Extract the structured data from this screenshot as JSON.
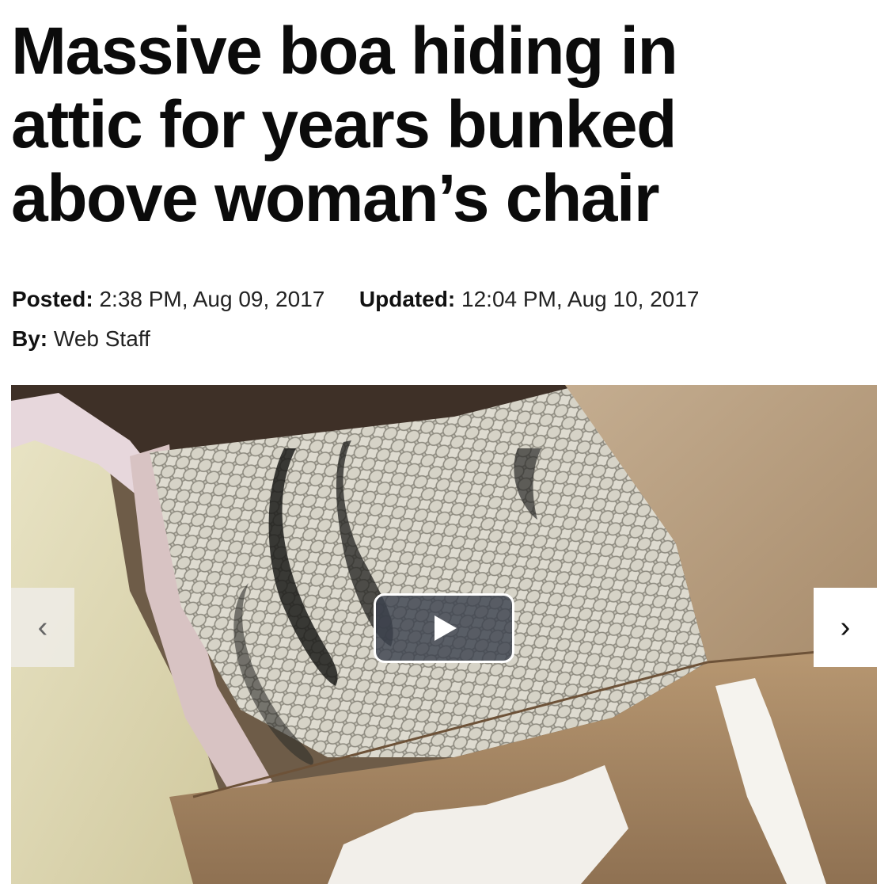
{
  "article": {
    "headline_lines": [
      "Massive boa hiding in",
      "attic for years bunked",
      "above woman’s chair"
    ],
    "posted_label": "Posted:",
    "posted_value": "2:38 PM, Aug 09, 2017",
    "updated_label": "Updated:",
    "updated_value": "12:04 PM, Aug 10, 2017",
    "byline_label": "By:",
    "byline_value": "Web Staff"
  },
  "media": {
    "prev_icon": "chevron-left-icon",
    "next_icon": "chevron-right-icon",
    "play_icon": "play-icon",
    "prev_glyph": "‹",
    "next_glyph": "›"
  }
}
